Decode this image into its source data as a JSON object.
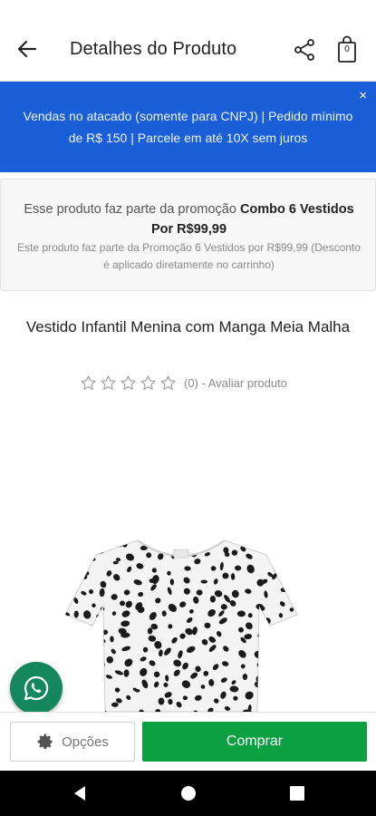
{
  "header": {
    "title": "Detalhes do Produto",
    "back_icon": "arrow-left-icon",
    "share_icon": "share-icon",
    "bag_icon": "shopping-bag-icon",
    "bag_count": "0"
  },
  "banner": {
    "text": "Vendas no atacado (somente para CNPJ) |  Pedido mínimo de R$ 150 | Parcele em até 10X sem juros",
    "close_label": "×",
    "color": "#1a5fd8"
  },
  "promo": {
    "prefix": "Esse produto faz parte da promoção ",
    "highlight": "Combo 6 Vestidos Por R$99,99",
    "detail": "Este produto faz parte da Promoção 6 Vestidos por R$99,99 (Desconto é aplicado diretamente no carrinho)"
  },
  "product": {
    "title": "Vestido Infantil Menina com Manga Meia Malha",
    "rating": 0,
    "rating_max": 5,
    "rating_text": "(0) - Avaliar produto",
    "image_description": "white dress with black leopard spots"
  },
  "whatsapp": {
    "icon": "whatsapp-icon",
    "color": "#14875e"
  },
  "actions": {
    "options_label": "Opções",
    "options_icon": "gear-icon",
    "buy_label": "Comprar",
    "buy_color": "#0ba142"
  },
  "system_nav": {
    "back_icon": "nav-back-icon",
    "home_icon": "nav-home-icon",
    "recent_icon": "nav-recent-apps-icon"
  }
}
